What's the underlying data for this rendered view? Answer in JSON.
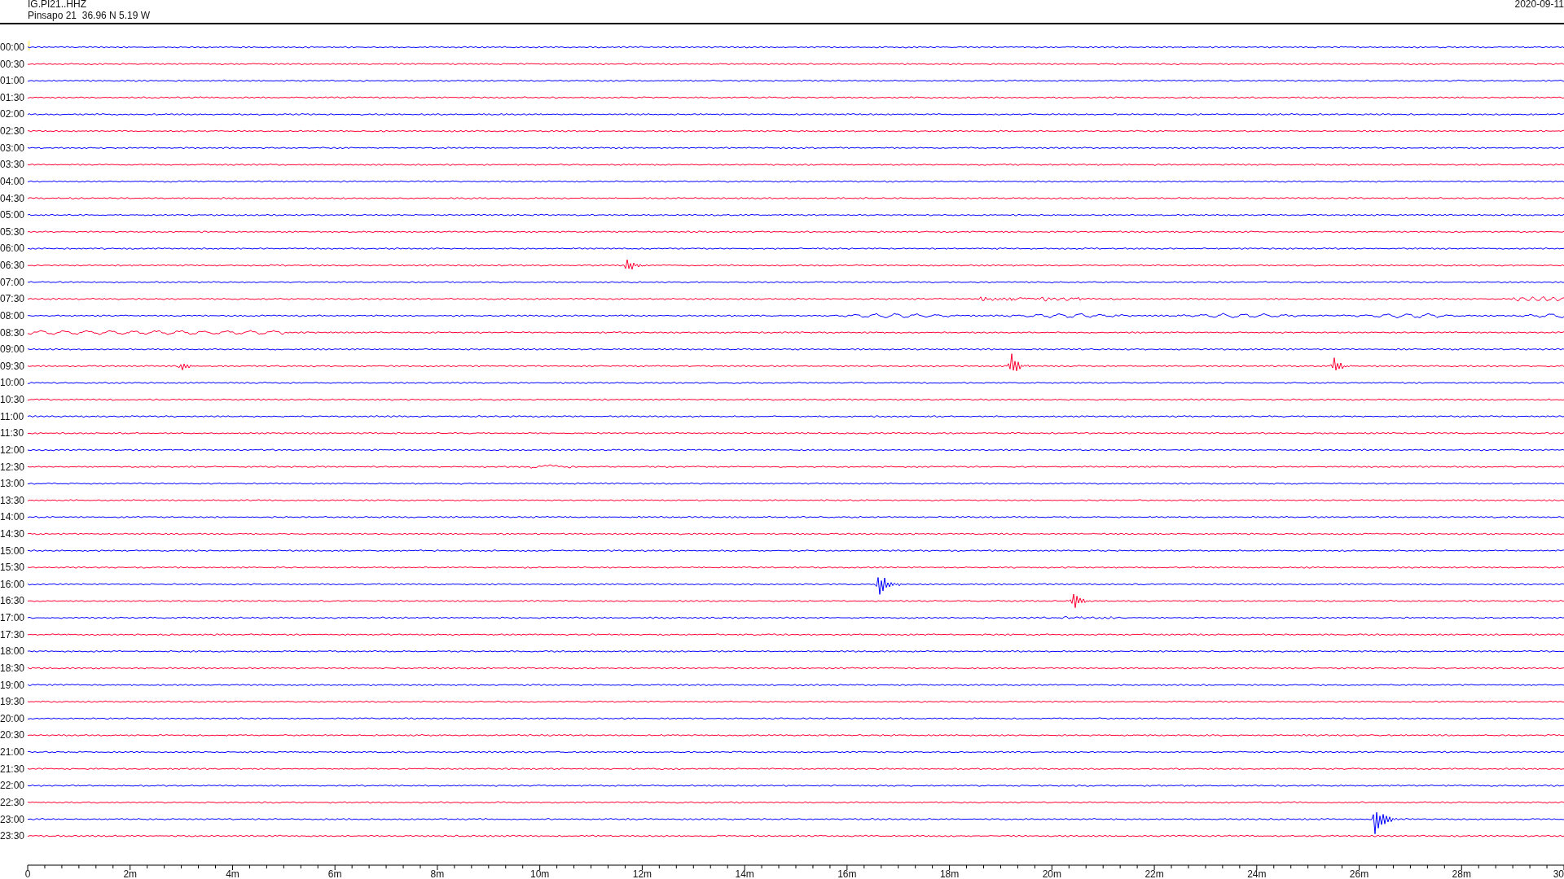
{
  "header": {
    "station": "IG.PI21..HHZ",
    "location": "Pinsapo 21  36.96 N 5.19 W",
    "date": "2020-09-11"
  },
  "rows": [
    {
      "time": "00:00",
      "color": "#0000ff"
    },
    {
      "time": "00:30",
      "color": "#ff0033"
    },
    {
      "time": "01:00",
      "color": "#0000ff"
    },
    {
      "time": "01:30",
      "color": "#ff0033"
    },
    {
      "time": "02:00",
      "color": "#0000ff"
    },
    {
      "time": "02:30",
      "color": "#ff0033"
    },
    {
      "time": "03:00",
      "color": "#0000ff"
    },
    {
      "time": "03:30",
      "color": "#ff0033"
    },
    {
      "time": "04:00",
      "color": "#0000ff"
    },
    {
      "time": "04:30",
      "color": "#ff0033"
    },
    {
      "time": "05:00",
      "color": "#0000ff"
    },
    {
      "time": "05:30",
      "color": "#ff0033"
    },
    {
      "time": "06:00",
      "color": "#0000ff"
    },
    {
      "time": "06:30",
      "color": "#ff0033"
    },
    {
      "time": "07:00",
      "color": "#0000ff"
    },
    {
      "time": "07:30",
      "color": "#ff0033"
    },
    {
      "time": "08:00",
      "color": "#0000ff"
    },
    {
      "time": "08:30",
      "color": "#ff0033"
    },
    {
      "time": "09:00",
      "color": "#0000ff"
    },
    {
      "time": "09:30",
      "color": "#ff0033"
    },
    {
      "time": "10:00",
      "color": "#0000ff"
    },
    {
      "time": "10:30",
      "color": "#ff0033"
    },
    {
      "time": "11:00",
      "color": "#0000ff"
    },
    {
      "time": "11:30",
      "color": "#ff0033"
    },
    {
      "time": "12:00",
      "color": "#0000ff"
    },
    {
      "time": "12:30",
      "color": "#ff0033"
    },
    {
      "time": "13:00",
      "color": "#0000ff"
    },
    {
      "time": "13:30",
      "color": "#ff0033"
    },
    {
      "time": "14:00",
      "color": "#0000ff"
    },
    {
      "time": "14:30",
      "color": "#ff0033"
    },
    {
      "time": "15:00",
      "color": "#0000ff"
    },
    {
      "time": "15:30",
      "color": "#ff0033"
    },
    {
      "time": "16:00",
      "color": "#0000ff"
    },
    {
      "time": "16:30",
      "color": "#ff0033"
    },
    {
      "time": "17:00",
      "color": "#0000ff"
    },
    {
      "time": "17:30",
      "color": "#ff0033"
    },
    {
      "time": "18:00",
      "color": "#0000ff"
    },
    {
      "time": "18:30",
      "color": "#ff0033"
    },
    {
      "time": "19:00",
      "color": "#0000ff"
    },
    {
      "time": "19:30",
      "color": "#ff0033"
    },
    {
      "time": "20:00",
      "color": "#0000ff"
    },
    {
      "time": "20:30",
      "color": "#ff0033"
    },
    {
      "time": "21:00",
      "color": "#0000ff"
    },
    {
      "time": "21:30",
      "color": "#ff0033"
    },
    {
      "time": "22:00",
      "color": "#0000ff"
    },
    {
      "time": "22:30",
      "color": "#ff0033"
    },
    {
      "time": "23:00",
      "color": "#0000ff"
    },
    {
      "time": "23:30",
      "color": "#ff0033"
    }
  ],
  "axis": {
    "ticks": [
      "0",
      "2m",
      "4m",
      "6m",
      "8m",
      "10m",
      "12m",
      "14m",
      "16m",
      "18m",
      "20m",
      "22m",
      "24m",
      "26m",
      "28m",
      "30"
    ]
  }
}
